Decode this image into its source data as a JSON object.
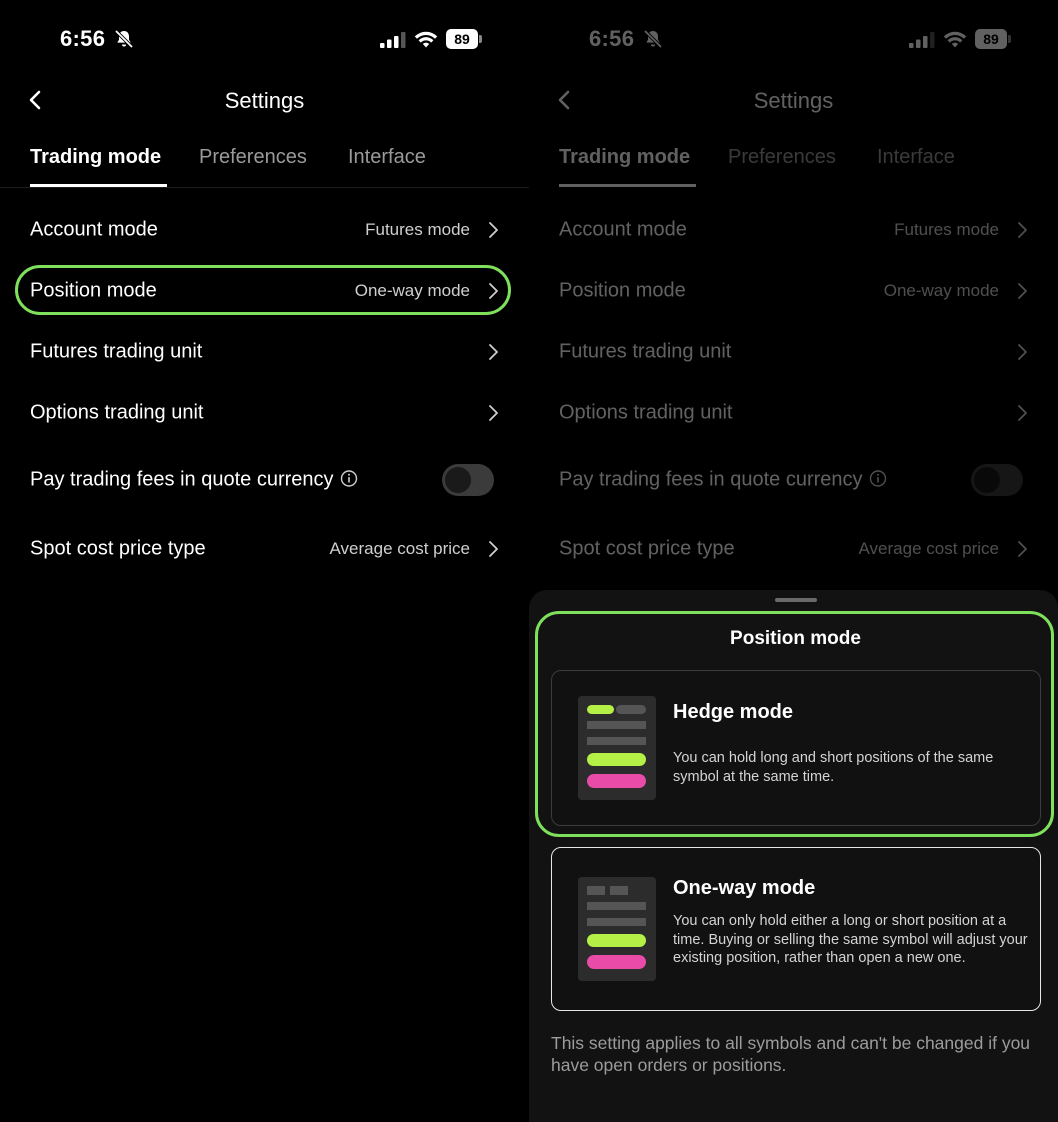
{
  "status_bar": {
    "time": "6:56",
    "battery": "89"
  },
  "header": {
    "title": "Settings"
  },
  "tabs": [
    {
      "label": "Trading mode",
      "active": true
    },
    {
      "label": "Preferences",
      "active": false
    },
    {
      "label": "Interface",
      "active": false
    }
  ],
  "rows": {
    "account_mode": {
      "label": "Account mode",
      "value": "Futures mode"
    },
    "position_mode": {
      "label": "Position mode",
      "value": "One-way mode"
    },
    "futures_unit": {
      "label": "Futures trading unit"
    },
    "options_unit": {
      "label": "Options trading unit"
    },
    "pay_fees": {
      "label": "Pay trading fees in quote currency",
      "toggle_on": false
    },
    "spot_cost": {
      "label": "Spot cost price type",
      "value": "Average cost price"
    }
  },
  "sheet": {
    "title": "Position mode",
    "options": {
      "hedge": {
        "title": "Hedge mode",
        "description": "You can hold long and short positions of the same symbol at the same time."
      },
      "oneway": {
        "title": "One-way mode",
        "description": "You can only hold either a long or short position at a time. Buying or selling the same symbol will adjust your existing position, rather than open a new one."
      }
    },
    "note": "This setting applies to all symbols and can't be changed if you have open orders or positions."
  },
  "colors": {
    "background": "#000000",
    "highlight": "#7fe05b",
    "long": "#b5f046",
    "short": "#e94ba8",
    "illustration_bar": "#555555"
  },
  "icons": [
    "bell-slash-icon",
    "signal-icon",
    "wifi-icon",
    "battery-icon",
    "back-chevron-icon",
    "chevron-right-icon",
    "info-icon"
  ]
}
